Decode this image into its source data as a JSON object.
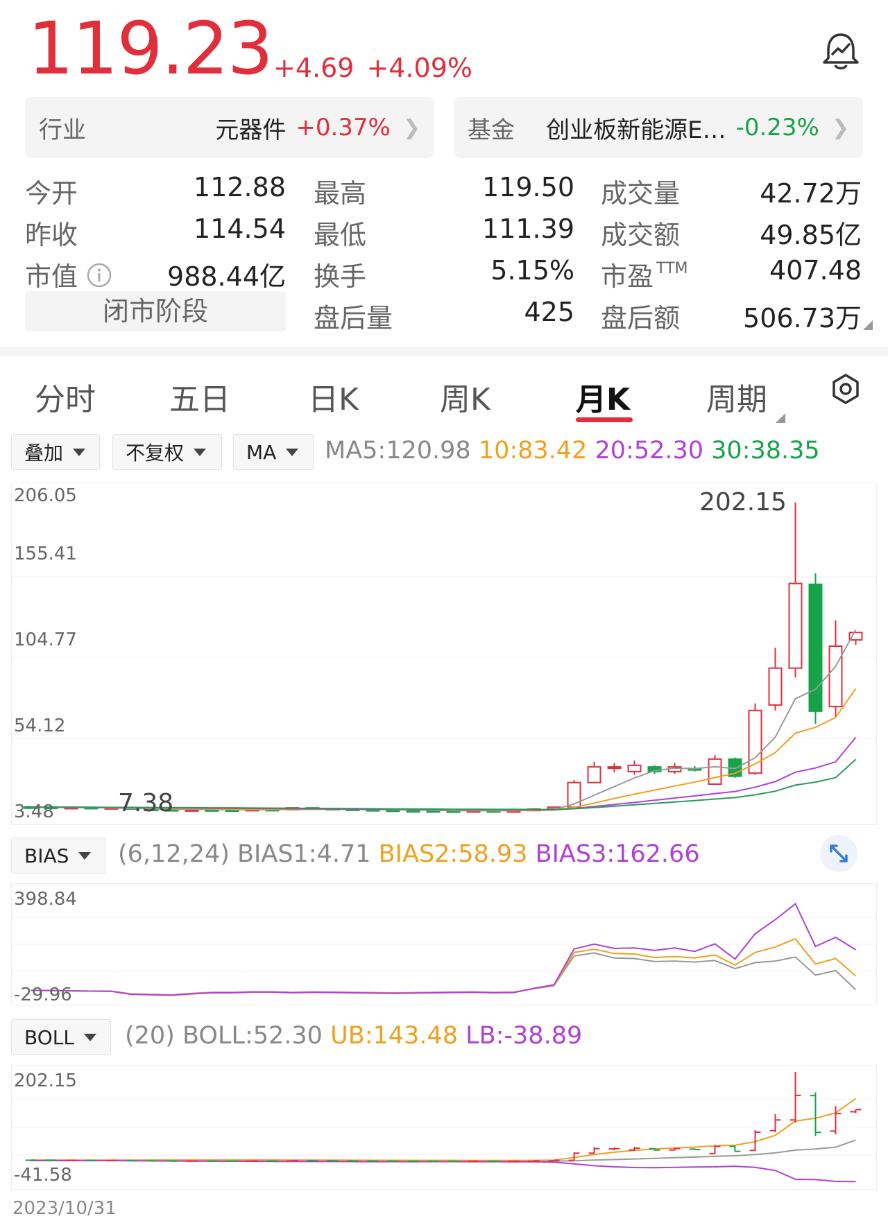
{
  "quote": {
    "price": "119.23",
    "change": "+4.69",
    "change_pct": "+4.09%"
  },
  "industry": {
    "label": "行业",
    "name": "元器件",
    "change": "+0.37%"
  },
  "fund": {
    "label": "基金",
    "name": "创业板新能源E…",
    "change": "-0.23%"
  },
  "stats": {
    "open": {
      "label": "今开",
      "value": "112.88"
    },
    "prev_close": {
      "label": "昨收",
      "value": "114.54"
    },
    "market_cap": {
      "label": "市值",
      "value": "988.44亿"
    },
    "high": {
      "label": "最高",
      "value": "119.50"
    },
    "low": {
      "label": "最低",
      "value": "111.39"
    },
    "turnover": {
      "label": "换手",
      "value": "5.15%"
    },
    "after_volume": {
      "label": "盘后量",
      "value": "425"
    },
    "volume": {
      "label": "成交量",
      "value": "42.72万"
    },
    "amount": {
      "label": "成交额",
      "value": "49.85亿"
    },
    "pe": {
      "label": "市盈",
      "sup": "TTM",
      "value": "407.48"
    },
    "after_amount": {
      "label": "盘后额",
      "value": "506.73万"
    }
  },
  "market_stage": "闭市阶段",
  "tabs": [
    "分时",
    "五日",
    "日K",
    "周K",
    "月K",
    "周期"
  ],
  "active_tab": 4,
  "toolbar": {
    "overlay": "叠加",
    "adjust": "不复权",
    "indicator": "MA"
  },
  "ma": {
    "ma5": "MA5:120.98",
    "ma10": "10:83.42",
    "ma20": "20:52.30",
    "ma30": "30:38.35"
  },
  "bias": {
    "selector": "BIAS",
    "params": "(6,12,24)",
    "bias1": "BIAS1:4.71",
    "bias2": "BIAS2:58.93",
    "bias3": "BIAS3:162.66"
  },
  "boll": {
    "selector": "BOLL",
    "params": "(20)",
    "boll": "BOLL:52.30",
    "ub": "UB:143.48",
    "lb": "LB:-38.89"
  },
  "date_label": "2023/10/31",
  "colors": {
    "up": "#e02f3a",
    "down": "#17a34a",
    "ma5": "#999999",
    "ma10": "#f0a020",
    "ma20": "#b040d8",
    "ma30": "#2a9a5a"
  },
  "chart_data": [
    {
      "type": "candlestick",
      "name": "月K",
      "y_ticks": [
        "206.05",
        "155.41",
        "104.77",
        "54.12",
        "3.48"
      ],
      "ylim": [
        3.48,
        206.05
      ],
      "annotations": [
        {
          "text": "202.15",
          "label": "max high"
        },
        {
          "text": "7.38",
          "label": "min low"
        }
      ],
      "candles": [
        {
          "o": 8.0,
          "c": 7.9,
          "h": 8.3,
          "l": 7.8
        },
        {
          "o": 7.9,
          "c": 7.8,
          "h": 8.1,
          "l": 7.6
        },
        {
          "o": 7.6,
          "c": 7.7,
          "h": 8.0,
          "l": 7.4
        },
        {
          "o": 7.7,
          "c": 7.4,
          "h": 7.9,
          "l": 7.3
        },
        {
          "o": 7.3,
          "c": 7.5,
          "h": 7.8,
          "l": 7.2
        },
        {
          "o": 7.5,
          "c": 6.6,
          "h": 7.6,
          "l": 6.4
        },
        {
          "o": 6.6,
          "c": 6.3,
          "h": 6.9,
          "l": 6.0
        },
        {
          "o": 6.3,
          "c": 6.0,
          "h": 6.6,
          "l": 5.5
        },
        {
          "o": 6.0,
          "c": 6.2,
          "h": 6.6,
          "l": 5.6
        },
        {
          "o": 6.2,
          "c": 6.1,
          "h": 6.5,
          "l": 5.8
        },
        {
          "o": 6.1,
          "c": 6.0,
          "h": 6.4,
          "l": 5.7
        },
        {
          "o": 6.0,
          "c": 6.4,
          "h": 6.8,
          "l": 5.8
        },
        {
          "o": 6.4,
          "c": 6.2,
          "h": 6.6,
          "l": 5.8
        },
        {
          "o": 6.2,
          "c": 7.4,
          "h": 7.6,
          "l": 6.1
        },
        {
          "o": 7.4,
          "c": 7.0,
          "h": 7.6,
          "l": 6.6
        },
        {
          "o": 7.0,
          "c": 6.6,
          "h": 7.2,
          "l": 6.2
        },
        {
          "o": 6.6,
          "c": 6.3,
          "h": 6.9,
          "l": 6.0
        },
        {
          "o": 6.3,
          "c": 6.0,
          "h": 6.5,
          "l": 5.6
        },
        {
          "o": 6.0,
          "c": 5.7,
          "h": 6.3,
          "l": 5.3
        },
        {
          "o": 5.7,
          "c": 5.6,
          "h": 6.0,
          "l": 5.2
        },
        {
          "o": 5.6,
          "c": 5.5,
          "h": 5.9,
          "l": 5.1
        },
        {
          "o": 5.5,
          "c": 5.4,
          "h": 5.8,
          "l": 5.0
        },
        {
          "o": 5.4,
          "c": 5.6,
          "h": 6.0,
          "l": 5.1
        },
        {
          "o": 5.6,
          "c": 5.3,
          "h": 5.9,
          "l": 4.8
        },
        {
          "o": 5.3,
          "c": 5.6,
          "h": 5.9,
          "l": 5.0
        },
        {
          "o": 5.6,
          "c": 6.6,
          "h": 7.2,
          "l": 5.3
        },
        {
          "o": 6.6,
          "c": 7.8,
          "h": 8.3,
          "l": 6.4
        },
        {
          "o": 7.8,
          "c": 23.5,
          "h": 25.0,
          "l": 7.6
        },
        {
          "o": 23.5,
          "c": 33.5,
          "h": 36.8,
          "l": 23.0
        },
        {
          "o": 33.0,
          "c": 33.5,
          "h": 36.0,
          "l": 30.0
        },
        {
          "o": 30.5,
          "c": 34.5,
          "h": 37.5,
          "l": 28.5
        },
        {
          "o": 33.5,
          "c": 30.5,
          "h": 34.5,
          "l": 29.0
        },
        {
          "o": 30.5,
          "c": 33.5,
          "h": 36.0,
          "l": 29.0
        },
        {
          "o": 32.5,
          "c": 31.5,
          "h": 34.0,
          "l": 30.5
        },
        {
          "o": 22.5,
          "c": 38.5,
          "h": 41.0,
          "l": 22.0
        },
        {
          "o": 38.5,
          "c": 27.5,
          "h": 39.5,
          "l": 26.5
        },
        {
          "o": 29.5,
          "c": 69.5,
          "h": 74.0,
          "l": 28.5
        },
        {
          "o": 73.0,
          "c": 96.5,
          "h": 109.5,
          "l": 69.5
        },
        {
          "o": 96.5,
          "c": 150.5,
          "h": 202.15,
          "l": 90.5
        },
        {
          "o": 150.0,
          "c": 69.0,
          "h": 157.0,
          "l": 61.0
        },
        {
          "o": 72.0,
          "c": 110.5,
          "h": 127.0,
          "l": 65.0
        },
        {
          "o": 114.54,
          "c": 119.23,
          "h": 119.5,
          "l": 111.39
        }
      ],
      "ma": {
        "ma5": [
          7.8,
          7.7,
          7.6,
          7.5,
          7.3,
          7.0,
          6.8,
          6.5,
          6.4,
          6.3,
          6.2,
          6.2,
          6.2,
          6.4,
          6.6,
          6.7,
          6.6,
          6.5,
          6.2,
          6.0,
          5.8,
          5.6,
          5.5,
          5.5,
          5.5,
          5.8,
          6.2,
          9.9,
          15.4,
          20.9,
          26.5,
          31.1,
          32.7,
          32.4,
          33.6,
          32.4,
          39.3,
          52.5,
          77.0,
          83.0,
          97.6,
          120.98
        ],
        "ma10": [
          7.8,
          7.8,
          7.7,
          7.7,
          7.6,
          7.4,
          7.3,
          7.0,
          6.9,
          6.8,
          6.6,
          6.5,
          6.4,
          6.4,
          6.4,
          6.4,
          6.4,
          6.3,
          6.3,
          6.2,
          6.2,
          6.1,
          6.0,
          5.9,
          5.8,
          5.8,
          5.9,
          7.7,
          10.4,
          13.4,
          16.1,
          18.7,
          21.3,
          23.8,
          26.7,
          29.4,
          35.4,
          42.6,
          55.0,
          58.8,
          65.0,
          83.42
        ],
        "ma20": [
          7.8,
          7.8,
          7.8,
          7.7,
          7.7,
          7.6,
          7.5,
          7.4,
          7.3,
          7.2,
          7.1,
          7.0,
          6.9,
          6.8,
          6.7,
          6.6,
          6.5,
          6.4,
          6.4,
          6.3,
          6.3,
          6.3,
          6.2,
          6.2,
          6.1,
          6.1,
          6.1,
          6.9,
          8.2,
          9.5,
          10.8,
          12.2,
          13.6,
          15.0,
          16.5,
          17.8,
          20.6,
          24.1,
          30.1,
          32.8,
          36.7,
          52.3
        ],
        "ma30": [
          7.8,
          7.8,
          7.8,
          7.8,
          7.7,
          7.7,
          7.6,
          7.6,
          7.5,
          7.4,
          7.4,
          7.3,
          7.2,
          7.1,
          7.0,
          6.9,
          6.9,
          6.8,
          6.7,
          6.6,
          6.6,
          6.5,
          6.5,
          6.4,
          6.4,
          6.3,
          6.3,
          6.8,
          7.6,
          8.4,
          9.3,
          10.2,
          11.1,
          12.0,
          13.0,
          13.9,
          15.7,
          18.0,
          21.9,
          23.8,
          26.6,
          38.35
        ]
      }
    },
    {
      "type": "line",
      "name": "BIAS",
      "y_ticks": [
        "398.84",
        "-29.96"
      ],
      "ylim": [
        -29.96,
        398.84
      ],
      "series": [
        {
          "name": "BIAS1",
          "values": [
            2,
            1,
            0,
            -1,
            -2,
            -12,
            -14,
            -16,
            -10,
            -6,
            -6,
            -4,
            -4,
            -6,
            -4,
            -5,
            -6,
            -7,
            -8,
            -7,
            -6,
            -5,
            -4,
            -6,
            -5,
            8,
            20,
            138,
            150,
            130,
            128,
            116,
            118,
            114,
            120,
            88,
            112,
            118,
            134,
            62,
            80,
            4.71
          ]
        },
        {
          "name": "BIAS2",
          "values": [
            2,
            1,
            0,
            -1,
            -2,
            -13,
            -15,
            -17,
            -11,
            -7,
            -7,
            -5,
            -5,
            -7,
            -5,
            -6,
            -7,
            -8,
            -9,
            -8,
            -7,
            -6,
            -5,
            -7,
            -6,
            9,
            22,
            152,
            165,
            148,
            146,
            132,
            136,
            130,
            142,
            102,
            152,
            174,
            206,
            106,
            128,
            58.93
          ]
        },
        {
          "name": "BIAS3",
          "values": [
            2,
            1,
            0,
            -1,
            -2,
            -14,
            -16,
            -18,
            -12,
            -8,
            -8,
            -5,
            -5,
            -8,
            -6,
            -7,
            -8,
            -9,
            -10,
            -9,
            -8,
            -7,
            -6,
            -8,
            -7,
            10,
            24,
            166,
            185,
            168,
            170,
            160,
            170,
            156,
            186,
            126,
            226,
            282,
            345,
            176,
            212,
            162.66
          ]
        }
      ]
    },
    {
      "type": "line",
      "name": "BOLL",
      "y_ticks": [
        "202.15",
        "-41.58"
      ],
      "ylim": [
        -41.58,
        202.15
      ],
      "series": [
        {
          "name": "BOLL",
          "values": [
            7.8,
            7.8,
            7.8,
            7.7,
            7.7,
            7.6,
            7.5,
            7.4,
            7.3,
            7.2,
            7.1,
            7.0,
            6.9,
            6.8,
            6.7,
            6.6,
            6.5,
            6.4,
            6.4,
            6.3,
            6.3,
            6.3,
            6.2,
            6.2,
            6.1,
            6.1,
            6.1,
            6.9,
            8.2,
            9.5,
            10.8,
            12.2,
            13.6,
            15.0,
            16.5,
            17.8,
            20.6,
            24.1,
            30.1,
            32.8,
            36.7,
            52.3
          ]
        },
        {
          "name": "UB",
          "values": [
            8.5,
            8.5,
            8.4,
            8.4,
            8.4,
            8.4,
            8.5,
            8.6,
            8.6,
            8.6,
            8.6,
            8.5,
            8.5,
            8.4,
            8.3,
            8.2,
            8.1,
            8.0,
            7.9,
            7.8,
            7.7,
            7.7,
            7.6,
            7.6,
            7.6,
            7.8,
            8.4,
            14.0,
            20.5,
            25.6,
            29.6,
            32.8,
            35.0,
            36.8,
            39.6,
            40.8,
            48.8,
            62.7,
            94.0,
            100.2,
            112.0,
            143.48
          ]
        },
        {
          "name": "LB",
          "values": [
            7.1,
            7.1,
            7.2,
            7.0,
            7.0,
            6.8,
            6.5,
            6.2,
            6.0,
            5.8,
            5.6,
            5.5,
            5.3,
            5.2,
            5.1,
            5.0,
            4.9,
            4.8,
            4.9,
            4.8,
            4.9,
            4.9,
            4.8,
            4.8,
            4.6,
            4.4,
            3.8,
            -0.2,
            -4.1,
            -6.6,
            -8.0,
            -8.4,
            -7.8,
            -6.8,
            -6.6,
            -5.2,
            -7.6,
            -14.5,
            -33.8,
            -34.6,
            -38.6,
            -38.89
          ]
        }
      ]
    }
  ]
}
